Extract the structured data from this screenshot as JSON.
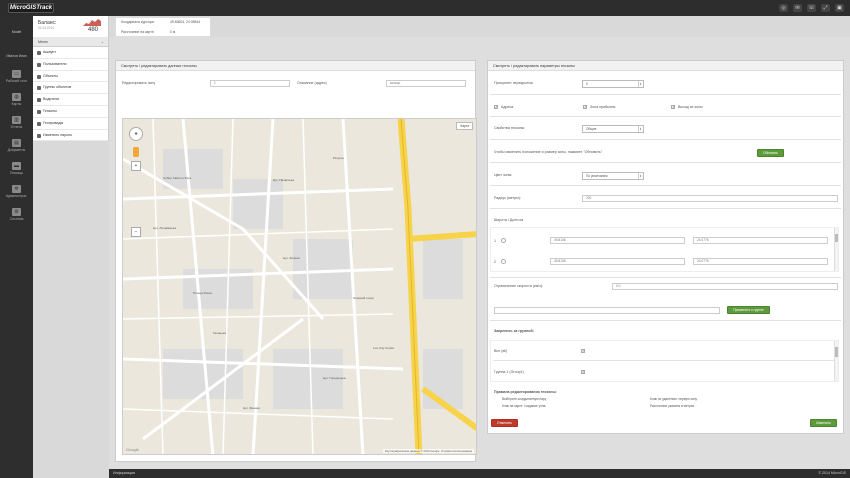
{
  "app": {
    "logo": "MicroGISTrack"
  },
  "topbar": {
    "icons": [
      "settings-icon",
      "message-icon",
      "phone-icon",
      "fullscreen-icon",
      "lock-icon"
    ]
  },
  "sidebar": {
    "user_top": "Model",
    "user_name": "Иванов Иван",
    "items": [
      {
        "label": "Рабочий стол",
        "icon": "monitor-icon",
        "glyph": "▭"
      },
      {
        "label": "Карты",
        "icon": "globe-icon",
        "glyph": "◍"
      },
      {
        "label": "Отчеты",
        "icon": "chart-icon",
        "glyph": "▥"
      },
      {
        "label": "Документы",
        "icon": "document-icon",
        "glyph": "▤"
      },
      {
        "label": "Помощь",
        "icon": "help-icon",
        "glyph": "▬"
      },
      {
        "label": "Администрат.",
        "icon": "gear-icon",
        "glyph": "✲"
      },
      {
        "label": "Система",
        "icon": "system-icon",
        "glyph": "⚙"
      }
    ]
  },
  "balance": {
    "title": "Баланс:",
    "date": "01.04.2014",
    "value": "480",
    "badge": "1"
  },
  "menu": {
    "header": "Меню",
    "items": [
      "Аккаунт",
      "Пользователи",
      "Объекты",
      "Группы объектов",
      "Водители",
      "Геозоны",
      "Геопровады",
      "Изменить пароль"
    ]
  },
  "coords": {
    "cursor_label": "Координаты курсора:",
    "cursor_value": "49.83603, 24.05844",
    "distance_label": "Расстояние на карте:",
    "distance_value": "0 м"
  },
  "left_panel": {
    "title": "Смотреть / редактировать данные геозоны",
    "zone_label": "Редактировать зону",
    "zone_value": "1",
    "desc_label": "Описание (адрес)",
    "desc_value": "кольцо",
    "map_type": "Карта",
    "attribution": "Картографические данные © 2014 Google",
    "report": "Условия использования",
    "google": "Google"
  },
  "right_panel": {
    "title": "Смотреть / редактировать параметры геозоны",
    "priority_label": "Приоритет перекрытия:",
    "priority_value": "0",
    "checks": [
      {
        "label": "Адреса",
        "checked": true
      },
      {
        "label": "Зона прибытия",
        "checked": true
      },
      {
        "label": "Выход из зоны",
        "checked": true
      }
    ],
    "props_label": "Свойства геозоны:",
    "props_value": "Общие",
    "hint": "Чтобы изменить положение и размер зоны, нажмите \"Обновить\".",
    "refresh_btn": "Обновить",
    "color_label": "Цвет зоны:",
    "color_value": "По умолчанию",
    "radius_label": "Радиус (метры):",
    "radius_value": "200",
    "latlng_label": "Широта / Долгота",
    "points": [
      {
        "n": "1",
        "lat": "49.8136",
        "lng": "24.0776"
      },
      {
        "n": "2",
        "lat": "49.8136",
        "lng": "24.0776"
      }
    ],
    "speed_label": "Ограничение скорости (км/ч):",
    "speed_value": "0.0",
    "apply_btn": "Применить к группе",
    "assign_label": "Закрепить за группой:",
    "groups": [
      {
        "label": "Все (all)",
        "checked": true
      },
      {
        "label": "Группа 1 (Group1)",
        "checked": true
      }
    ],
    "rules_title": "Правила редактирования геозоны:",
    "rules": [
      "Выберите координатную пару",
      "Клик по удалению: первую зону.",
      "Клик на карте: создание узла.",
      "Расстояние указаны в метрах."
    ],
    "cancel_btn": "Отменить",
    "save_btn": "Изменить"
  },
  "map_labels": [
    "вул. Пекарська",
    "вул. Личаківська",
    "вул. Зелена",
    "Ратуша",
    "Собор Святого Юра",
    "вул. Городоцька",
    "Галицька",
    "Площа Ринок",
    "Оперний театр",
    "вул. Франка",
    "Lviv City Center"
  ],
  "footer": {
    "info": "Информация",
    "copyright": "© 2014 MicroGIS"
  }
}
